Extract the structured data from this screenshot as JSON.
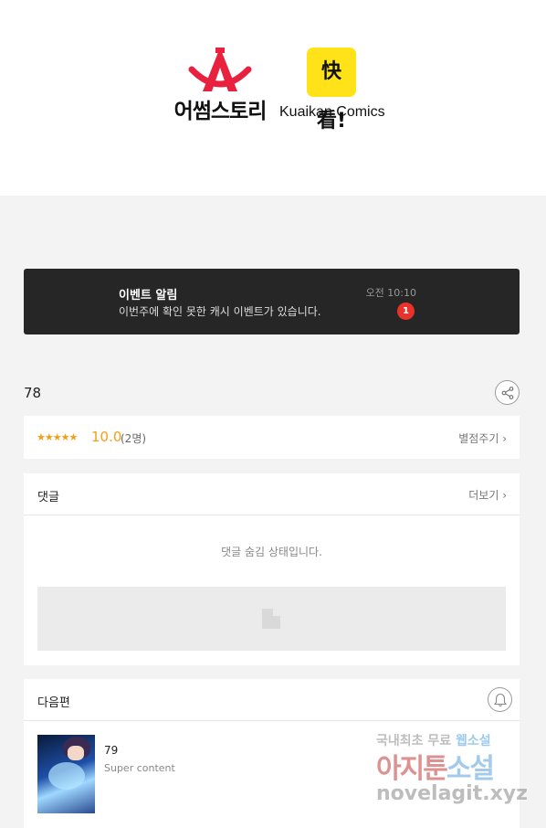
{
  "brands": {
    "awesome_story": "어썸스토리",
    "kuaikan_badge": "快看!",
    "kuaikan_name": "Kuaikan Comics"
  },
  "event": {
    "title": "이벤트 알림",
    "description": "이번주에 확인 못한 캐시 이벤트가 있습니다.",
    "time": "오전 10:10",
    "badge": "1"
  },
  "episode": {
    "title": "78"
  },
  "rating": {
    "stars": "★★★★★",
    "score": "10.0",
    "count": "(2명)",
    "rate_button": "별점주기 ›"
  },
  "comments": {
    "title": "댓글",
    "more": "더보기 ›",
    "hidden_message": "댓글 숨김 상태입니다."
  },
  "next": {
    "title": "다음편",
    "episode_number": "79",
    "episode_subtitle": "Super content"
  },
  "watermark": {
    "line1_prefix": "국내최초 무료 ",
    "line1_highlight": "웹소설",
    "line2_prefix": "아지툰",
    "line2_highlight": "소설",
    "line3": "novelagit.xyz"
  },
  "colors": {
    "awesome_red": "#e8213f",
    "kuaikan_yellow": "#ffe318",
    "rating_orange": "#f59d16",
    "badge_red": "#e8322b",
    "banner_dark": "#262626"
  }
}
